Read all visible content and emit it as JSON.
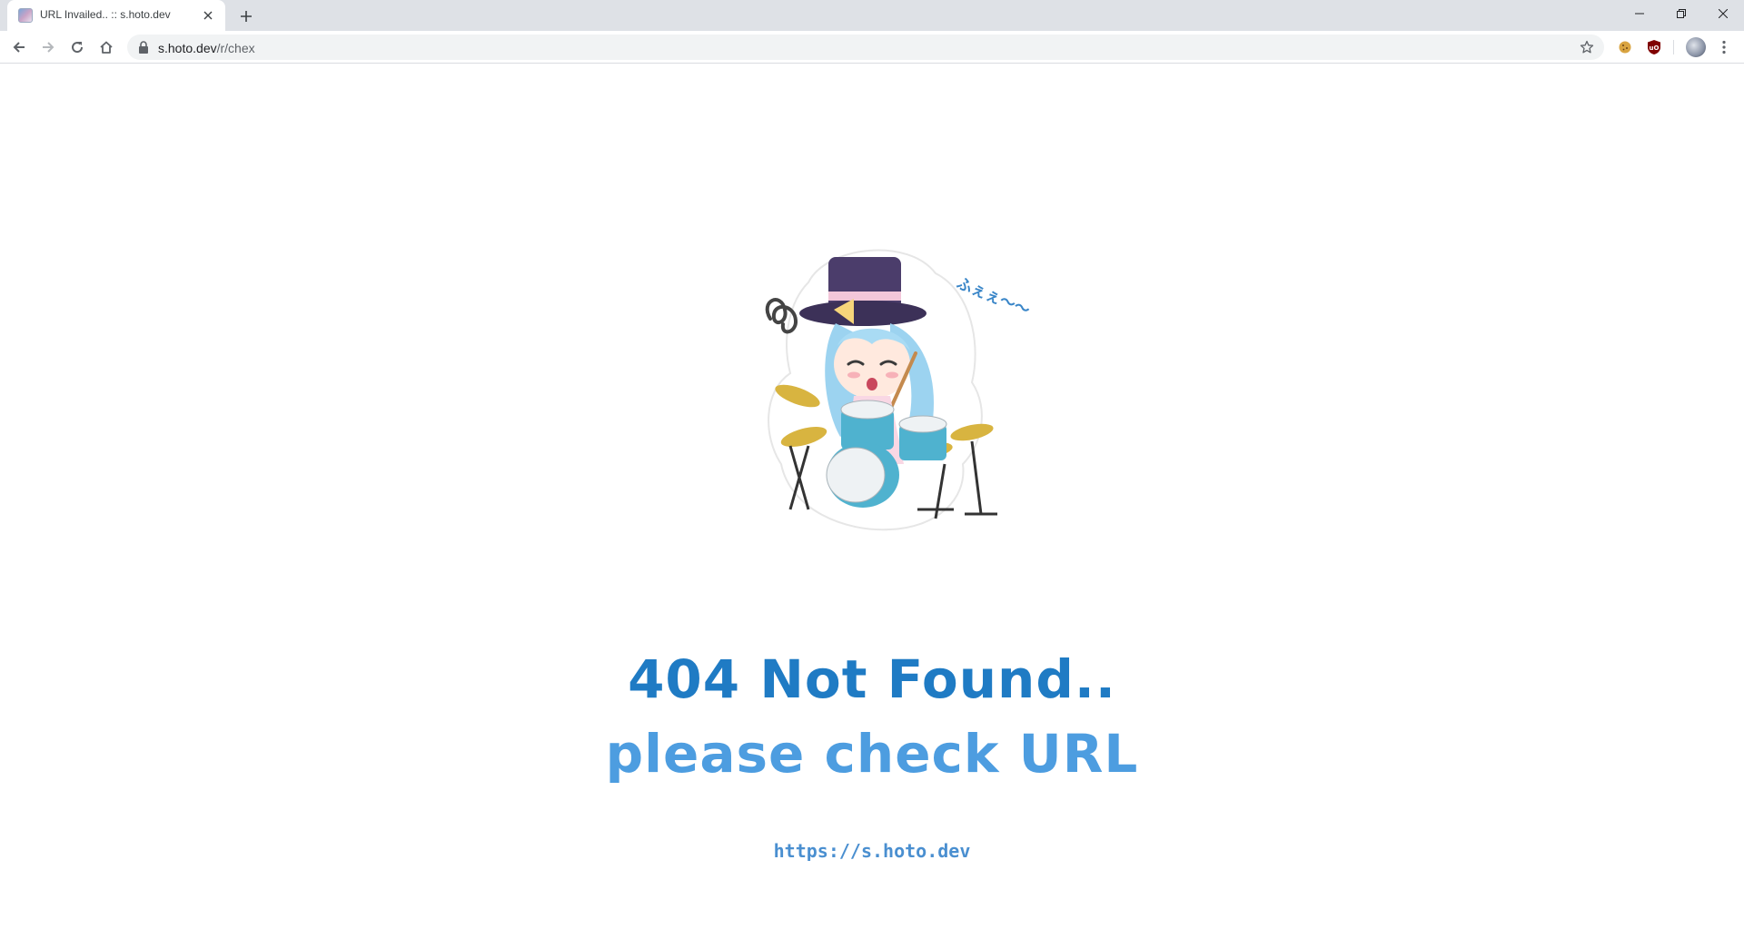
{
  "browser": {
    "tab": {
      "title": "URL Invailed.. :: s.hoto.dev",
      "favicon": "site-favicon"
    },
    "address_bar": {
      "host": "s.hoto.dev",
      "path": "/r/chex"
    },
    "icons": {
      "back": "back-arrow-icon",
      "forward": "forward-arrow-icon",
      "reload": "reload-icon",
      "home": "home-icon",
      "lock": "lock-icon",
      "bookmark": "star-icon",
      "extension_cookie": "cookie-extension-icon",
      "extension_ublock": "ublock-shield-icon",
      "profile": "profile-avatar",
      "menu": "kebab-menu-icon"
    }
  },
  "page": {
    "heading": "404 Not Found..",
    "subheading": "please check URL",
    "link": "https://s.hoto.dev",
    "sticker_text": "ふぇぇ〜〜",
    "illustration": "chibi-drummer-girl-sticker"
  },
  "colors": {
    "heading": "#1f7bc4",
    "subheading": "#4d9de0",
    "link": "#4a8fd0",
    "tabstrip": "#dee1e6",
    "omnibox": "#f1f3f4"
  }
}
